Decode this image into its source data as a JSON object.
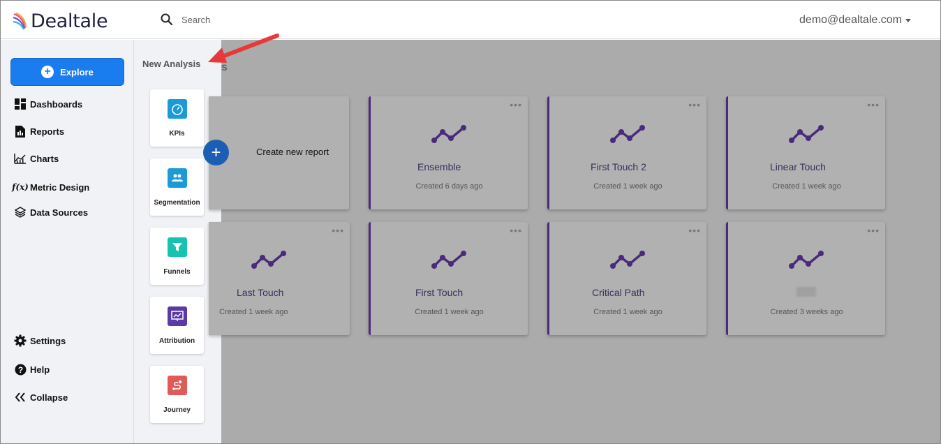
{
  "header": {
    "logo_text": "Dealtale",
    "search_placeholder": "Search",
    "user_email": "demo@dealtale.com"
  },
  "sidebar": {
    "explore_label": "Explore",
    "items": [
      {
        "label": "Dashboards",
        "icon": "dashboard-icon"
      },
      {
        "label": "Reports",
        "icon": "report-icon"
      },
      {
        "label": "Charts",
        "icon": "chart-icon"
      },
      {
        "label": "Metric Design",
        "icon": "function-icon"
      },
      {
        "label": "Data Sources",
        "icon": "layers-icon"
      }
    ],
    "bottom_items": [
      {
        "label": "Settings",
        "icon": "gear-icon"
      },
      {
        "label": "Help",
        "icon": "help-icon"
      },
      {
        "label": "Collapse",
        "icon": "double-chevron-left-icon"
      }
    ]
  },
  "drawer": {
    "title": "New Analysis",
    "tiles": [
      {
        "label": "KPIs",
        "icon": "gauge-icon",
        "color": "#1a9bd7"
      },
      {
        "label": "Segmentation",
        "icon": "people-icon",
        "color": "#1a9bd7"
      },
      {
        "label": "Funnels",
        "icon": "funnel-icon",
        "color": "#17c2b0"
      },
      {
        "label": "Attribution",
        "icon": "presentation-icon",
        "color": "#5b3aa6"
      },
      {
        "label": "Journey",
        "icon": "route-icon",
        "color": "#e05a57"
      }
    ]
  },
  "main": {
    "create_label": "Create new report",
    "cards": [
      {
        "name": "Ensemble",
        "created": "Created 6 days ago"
      },
      {
        "name": "First Touch 2",
        "created": "Created 1 week ago"
      },
      {
        "name": "Linear Touch",
        "created": "Created 1 week ago"
      },
      {
        "name": "Last Touch",
        "created": "Created 1 week ago"
      },
      {
        "name": "First Touch",
        "created": "Created 1 week ago"
      },
      {
        "name": "Critical Path",
        "created": "Created 1 week ago"
      },
      {
        "name": "",
        "created": "Created 3 weeks ago"
      }
    ],
    "more_label": "•••"
  },
  "colors": {
    "accent": "#1b7cf0",
    "card_purple": "#4a2a7a",
    "arrow_red": "#e8393a"
  }
}
